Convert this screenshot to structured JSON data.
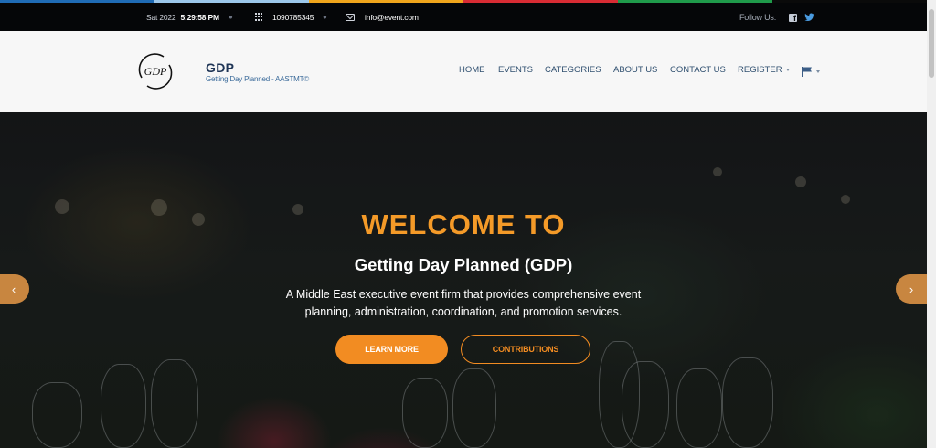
{
  "colors": {
    "strip": [
      "#1f6bb5",
      "#9cc7ea",
      "#f0a51c",
      "#d92c34",
      "#1f9a4a",
      "#0a0a0a"
    ],
    "accent": "#f28c22",
    "topbar_bg": "#050608",
    "nav_text": "#2f4f6f"
  },
  "topbar": {
    "date_label": "Sat 2022",
    "time": "5:29:58 PM",
    "phone": "1090785345",
    "email": "info@event.com",
    "follow_label": "Follow Us:",
    "icons": {
      "phone": "keypad-icon",
      "email": "envelope-icon",
      "facebook": "facebook-icon",
      "twitter": "twitter-icon"
    }
  },
  "header": {
    "logo_text": "GDP",
    "brand_title": "GDP",
    "brand_subtitle": "Getting Day Planned - AASTMT©",
    "nav": {
      "home": "HOME",
      "events": "EVENTS",
      "categories": "CATEGORIES",
      "about": "ABOUT US",
      "contact": "CONTACT US",
      "register": "REGISTER",
      "language_icon": "flag-icon"
    }
  },
  "hero": {
    "welcome": "WELCOME TO",
    "title": "Getting Day Planned (GDP)",
    "description": "A Middle East executive event firm that provides comprehensive event planning, administration, coordination, and promotion services.",
    "learn_more": "LEARN MORE",
    "contributions": "CONTRIBUTIONS",
    "prev_icon": "chevron-left-icon",
    "next_icon": "chevron-right-icon"
  }
}
